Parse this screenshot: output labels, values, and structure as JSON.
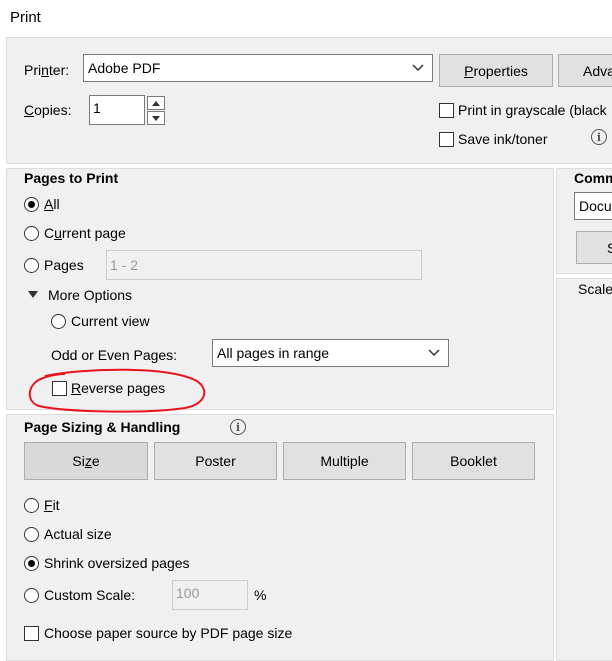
{
  "window": {
    "title": "Print"
  },
  "printer": {
    "label": "Printer:",
    "selected": "Adobe PDF",
    "properties_label": "Properties",
    "advanced_label": "Adva",
    "copies_label": "Copies:",
    "copies_value": "1",
    "grayscale_label": "Print in grayscale (black",
    "save_ink_label": "Save ink/toner"
  },
  "pages_to_print": {
    "heading": "Pages to Print",
    "all_label": "All",
    "current_page_label": "Current page",
    "pages_label": "Pages",
    "pages_value": "1 - 2",
    "more_options_label": "More Options",
    "current_view_label": "Current view",
    "odd_even_label": "Odd or Even Pages:",
    "odd_even_value": "All pages in range",
    "reverse_pages_label": "Reverse pages"
  },
  "sizing": {
    "heading": "Page Sizing & Handling",
    "tabs": [
      "Size",
      "Poster",
      "Multiple",
      "Booklet"
    ],
    "fit_label": "Fit",
    "actual_size_label": "Actual size",
    "shrink_label": "Shrink oversized pages",
    "custom_scale_label": "Custom Scale:",
    "custom_scale_value": "100",
    "percent": "%",
    "paper_source_label": "Choose paper source by PDF page size"
  },
  "right_panel": {
    "comments_heading": "Comm",
    "document_value": "Docu",
    "button_label": "S",
    "scale_label": "Scale"
  },
  "annotation": {
    "color": "#e8141c"
  }
}
